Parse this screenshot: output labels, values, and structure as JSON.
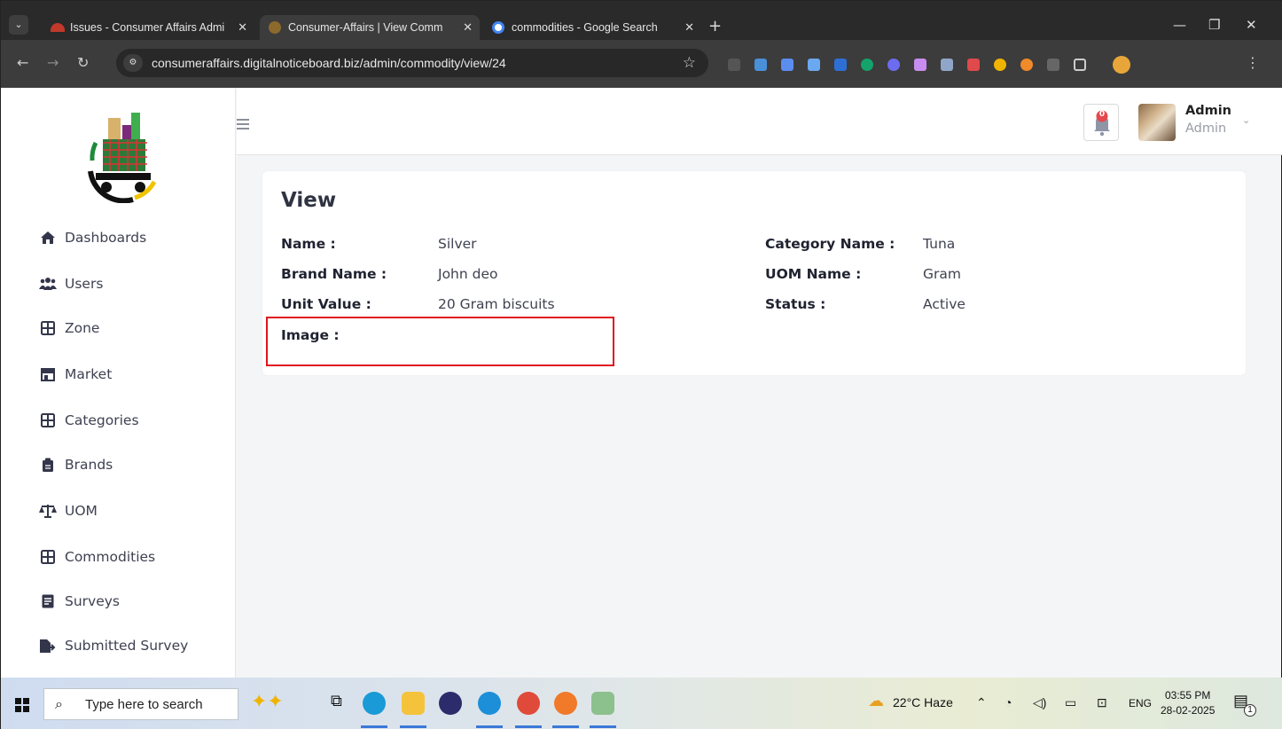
{
  "browser": {
    "tabs": [
      {
        "title": "Issues - Consumer Affairs Admi",
        "active": false
      },
      {
        "title": "Consumer-Affairs | View Comm",
        "active": true
      },
      {
        "title": "commodities - Google Search",
        "active": false
      }
    ],
    "url": "consumeraffairs.digitalnoticeboard.biz/admin/commodity/view/24"
  },
  "sidebar": {
    "items": [
      {
        "label": "Dashboards",
        "icon": "home-icon"
      },
      {
        "label": "Users",
        "icon": "users-icon"
      },
      {
        "label": "Zone",
        "icon": "grid-icon"
      },
      {
        "label": "Market",
        "icon": "store-icon"
      },
      {
        "label": "Categories",
        "icon": "grid-icon"
      },
      {
        "label": "Brands",
        "icon": "clipboard-icon"
      },
      {
        "label": "UOM",
        "icon": "scale-icon"
      },
      {
        "label": "Commodities",
        "icon": "grid-icon"
      },
      {
        "label": "Surveys",
        "icon": "form-icon"
      },
      {
        "label": "Submitted Survey",
        "icon": "file-export-icon"
      }
    ]
  },
  "header": {
    "notification_count": "0",
    "user_name": "Admin",
    "user_role": "Admin"
  },
  "view": {
    "title": "View",
    "name_label": "Name :",
    "name_value": "Silver",
    "brand_label": "Brand Name :",
    "brand_value": "John deo",
    "unit_label": "Unit Value :",
    "unit_value": "20 Gram biscuits",
    "image_label": "Image :",
    "category_label": "Category Name :",
    "category_value": "Tuna",
    "uom_label": "UOM Name :",
    "uom_value": "Gram",
    "status_label": "Status :",
    "status_value": "Active"
  },
  "taskbar": {
    "search_placeholder": "Type here to search",
    "weather": "22°C  Haze",
    "language": "ENG",
    "time": "03:55 PM",
    "date": "28-02-2025",
    "notification_count": "1"
  },
  "colors": {
    "highlight": "#e0141d",
    "sidebar_text": "#3e4151",
    "page_bg": "#f4f5f7"
  }
}
